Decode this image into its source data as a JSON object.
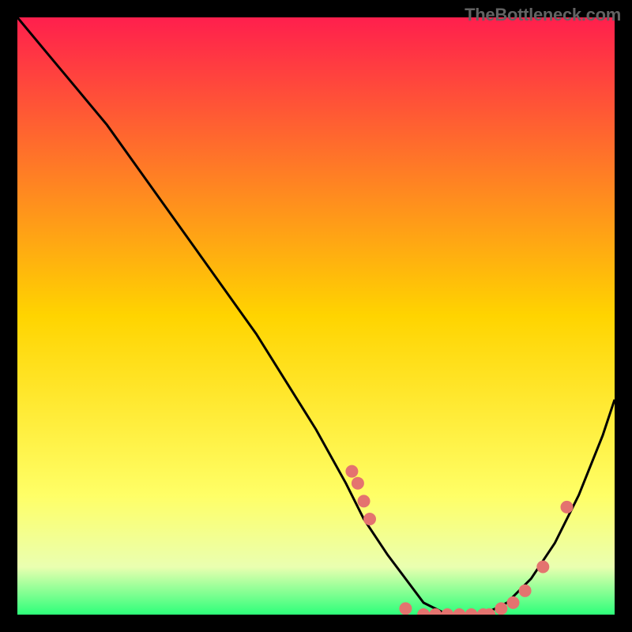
{
  "watermark": "TheBottleneck.com",
  "chart_data": {
    "type": "line",
    "title": "",
    "xlabel": "",
    "ylabel": "",
    "xlim": [
      0,
      100
    ],
    "ylim": [
      0,
      100
    ],
    "curve": {
      "x": [
        0,
        5,
        10,
        15,
        20,
        25,
        30,
        35,
        40,
        45,
        50,
        55,
        58,
        62,
        65,
        68,
        72,
        75,
        78,
        82,
        86,
        90,
        94,
        98,
        100
      ],
      "y": [
        100,
        94,
        88,
        82,
        75,
        68,
        61,
        54,
        47,
        39,
        31,
        22,
        16,
        10,
        6,
        2,
        0,
        0,
        0,
        2,
        6,
        12,
        20,
        30,
        36
      ]
    },
    "scatter": {
      "x": [
        56,
        57,
        58,
        59,
        65,
        68,
        70,
        72,
        74,
        76,
        78,
        79,
        81,
        83,
        85,
        88,
        92
      ],
      "y": [
        24,
        22,
        19,
        16,
        1,
        0,
        0,
        0,
        0,
        0,
        0,
        0,
        1,
        2,
        4,
        8,
        18
      ]
    },
    "gradient_stops": [
      {
        "offset": 0.0,
        "color": "#ff1f4d"
      },
      {
        "offset": 0.5,
        "color": "#ffd400"
      },
      {
        "offset": 0.8,
        "color": "#ffff66"
      },
      {
        "offset": 0.92,
        "color": "#eaffb0"
      },
      {
        "offset": 1.0,
        "color": "#2dff7a"
      }
    ],
    "point_color": "#e4736f",
    "line_color": "#000000"
  }
}
